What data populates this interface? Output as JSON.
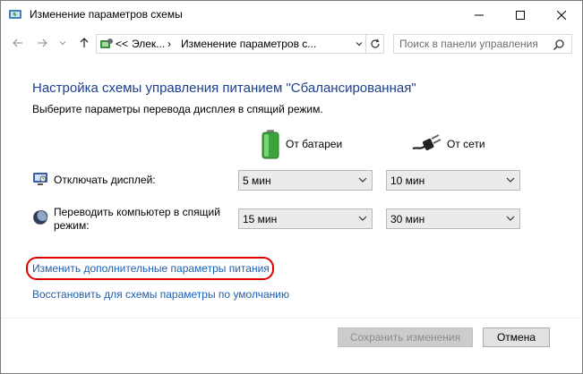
{
  "window": {
    "title": "Изменение параметров схемы",
    "controls": {
      "minimize": "—",
      "maximize": "☐",
      "close": "✕"
    }
  },
  "nav": {
    "breadcrumb": [
      "<<",
      "Элек...",
      "›",
      "Изменение параметров с..."
    ],
    "search_placeholder": "Поиск в панели управления"
  },
  "content": {
    "heading": "Настройка схемы управления питанием \"Сбалансированная\"",
    "subtitle": "Выберите параметры перевода дисплея в спящий режим.",
    "columns": {
      "battery": "От батареи",
      "ac": "От сети"
    },
    "rows": [
      {
        "label": "Отключать дисплей:",
        "icon": "monitor-icon",
        "battery_value": "5 мин",
        "ac_value": "10 мин"
      },
      {
        "label": "Переводить компьютер в спящий\nрежим:",
        "icon": "moon-icon",
        "battery_value": "15 мин",
        "ac_value": "30 мин"
      }
    ],
    "links": {
      "advanced": "Изменить дополнительные параметры питания",
      "restore": "Восстановить для схемы параметры по умолчанию"
    }
  },
  "footer": {
    "save_label": "Сохранить изменения",
    "cancel_label": "Отмена"
  },
  "colors": {
    "heading": "#1e3e8e",
    "link": "#1a5fb4",
    "highlight": "#e00000",
    "battery_green": "#3aa43a"
  }
}
